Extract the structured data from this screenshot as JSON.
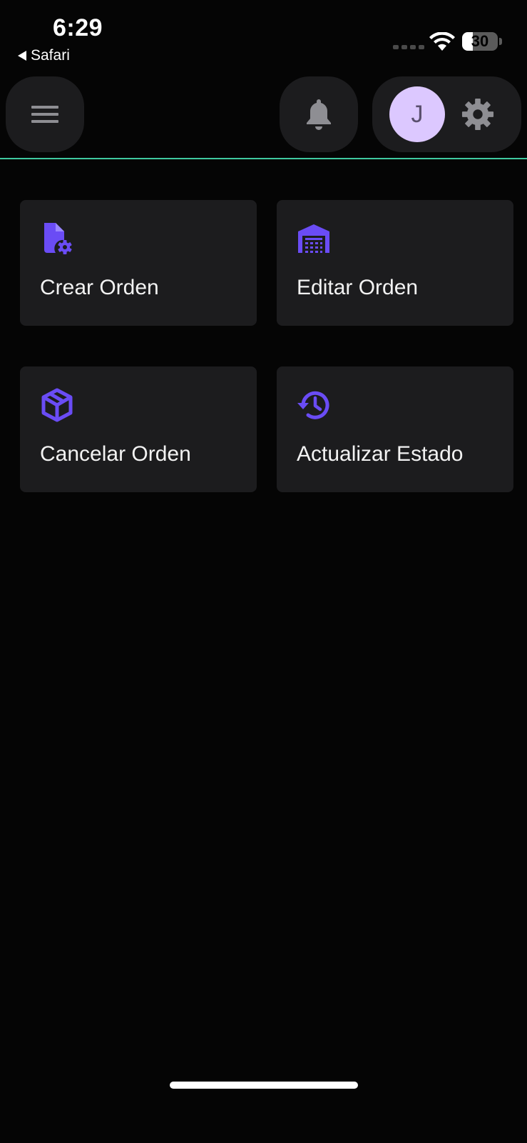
{
  "status_bar": {
    "time": "6:29",
    "back_app": "Safari",
    "battery_level": "30",
    "battery_fraction": 0.3
  },
  "header": {
    "avatar_initial": "J",
    "accent_color": "#3fc9a0"
  },
  "cards": [
    {
      "label": "Crear Orden",
      "icon": "file-settings-icon"
    },
    {
      "label": "Editar Orden",
      "icon": "warehouse-icon"
    },
    {
      "label": "Cancelar Orden",
      "icon": "box-icon"
    },
    {
      "label": "Actualizar Estado",
      "icon": "history-icon"
    }
  ],
  "colors": {
    "background": "#050505",
    "surface": "#1c1c1e",
    "icon_accent": "#6a4cf5",
    "avatar_bg": "#dcc8ff",
    "muted_icon": "#8e8e93"
  }
}
